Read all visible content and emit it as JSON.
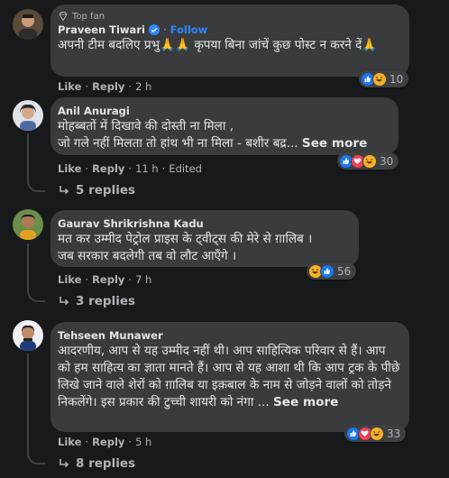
{
  "comments": [
    {
      "badge": "Top fan",
      "name": "Praveen Tiwari",
      "follow": "Follow",
      "text": "अपनी टीम बदलिए प्रभु🙏🙏 कृपया बिना जांचें कुछ पोस्ट न करने दें🙏",
      "like": "Like",
      "reply": "Reply",
      "time": "2 h",
      "reaction_count": "10",
      "reactions": [
        "like",
        "haha"
      ]
    },
    {
      "name": "Anil Anuragi",
      "text": "मोहब्बतों में दिखावे की दोस्ती ना मिला ,\nजो गले नहीं मिलता तो हांथ भी ना मिला - बशीर बद्र...",
      "see_more": "See more",
      "like": "Like",
      "reply": "Reply",
      "time": "11 h",
      "edited": "Edited",
      "reaction_count": "30",
      "reactions": [
        "like",
        "love",
        "haha"
      ],
      "replies": "5 replies"
    },
    {
      "name": "Gaurav Shrikrishna Kadu",
      "text": "मत कर उम्मीद पेट्रोल प्राइस के ट्वीट्स की मेरे से ग़ालिब ।\nजब सरकार बदलेगी तब वो लौट आएँगे ।",
      "like": "Like",
      "reply": "Reply",
      "time": "7 h",
      "reaction_count": "56",
      "reactions": [
        "haha",
        "like"
      ],
      "replies": "3 replies"
    },
    {
      "name": "Tehseen Munawer",
      "text": "आदरणीय, आप से यह उम्मीद नहीं थी। आप साहित्यिक परिवार से हैं। आप को हम साहित्य का ज्ञाता मानते हैं। आप से यह आशा थी कि आप ट्रक के पीछे लिखे जाने वाले शेरों को ग़ालिब या इक़बाल के नाम से जोड़ने वालों को तोड़ने निकलेंगे। इस प्रकार की टुच्ची शायरी को नंगा ...",
      "see_more": "See more",
      "like": "Like",
      "reply": "Reply",
      "time": "5 h",
      "reaction_count": "33",
      "reactions": [
        "like",
        "love",
        "haha"
      ],
      "replies": "8 replies"
    }
  ],
  "colors": {
    "background": "#18191a",
    "bubble": "#3a3b3c",
    "text": "#e4e6eb",
    "muted": "#b0b3b8",
    "link": "#2d88ff",
    "like": "#1877f2",
    "love": "#f33e58",
    "haha": "#f7b125"
  },
  "icons": {
    "top_fan": "diamond-badge-icon",
    "verified": "verified-check-icon",
    "reply_arrow": "reply-arrow-icon"
  }
}
